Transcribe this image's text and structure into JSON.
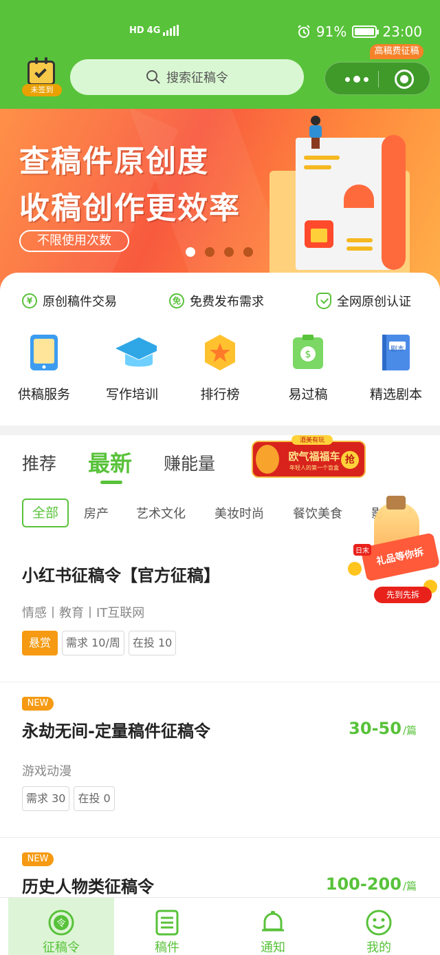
{
  "status_bar": {
    "network": "HD",
    "signal": "4G",
    "battery_pct": "91%",
    "time": "23:00"
  },
  "header": {
    "checkin_label": "未签到",
    "search_placeholder": "搜索征稿令"
  },
  "banner": {
    "line1": "查稿件原创度",
    "line2": "收稿创作更效率",
    "pill": "不限使用次数",
    "slide_count": 4,
    "active_slide": 1
  },
  "features": [
    "原创稿件交易",
    "免费发布需求",
    "全网原创认证"
  ],
  "feature_icons": [
    "yuan-circle-icon",
    "free-circle-icon",
    "shield-check-icon"
  ],
  "services": [
    {
      "label": "供稿服务",
      "icon": "tablet-icon"
    },
    {
      "label": "写作培训",
      "icon": "graduation-cap-icon"
    },
    {
      "label": "排行榜",
      "icon": "star-hexagon-icon"
    },
    {
      "label": "易过稿",
      "icon": "money-board-icon"
    },
    {
      "label": "精选剧本",
      "icon": "script-book-icon",
      "badge": "高稿费征稿",
      "book_text": "剧本"
    }
  ],
  "tabs": [
    {
      "label": "推荐",
      "active": false
    },
    {
      "label": "最新",
      "active": true
    },
    {
      "label": "赚能量",
      "active": false
    }
  ],
  "promo": {
    "top": "酒美有玩",
    "title": "欧气福福车",
    "sub": "年轻人的第一个盲盒",
    "action": "抢"
  },
  "categories": [
    "全部",
    "房产",
    "艺术文化",
    "美妆时尚",
    "餐饮美食",
    "影"
  ],
  "float_gift": {
    "tag": "礼品等你拆",
    "button": "先到先拆",
    "day_tag": "日末"
  },
  "listings": [
    {
      "is_new": false,
      "title": "小红书征稿令【官方征稿】",
      "tags": "情感丨教育丨IT互联网",
      "chips": [
        "悬赏",
        "需求 10/周",
        "在投 10"
      ],
      "price": "",
      "unit": ""
    },
    {
      "is_new": true,
      "new_label": "NEW",
      "title": "永劫无间-定量稿件征稿令",
      "tags": "游戏动漫",
      "chips": [
        "需求 30",
        "在投 0"
      ],
      "price": "30-50",
      "unit": "/篇"
    },
    {
      "is_new": true,
      "new_label": "NEW",
      "title": "历史人物类征稿令",
      "tags": "",
      "chips": [],
      "price": "100-200",
      "unit": "/篇"
    }
  ],
  "bottom_nav": [
    {
      "label": "征稿令",
      "icon": "ling-badge-icon",
      "active": true
    },
    {
      "label": "稿件",
      "icon": "document-list-icon",
      "active": false
    },
    {
      "label": "通知",
      "icon": "bell-icon",
      "active": false
    },
    {
      "label": "我的",
      "icon": "smiley-face-icon",
      "active": false
    }
  ],
  "colors": {
    "brand_green": "#58c23a",
    "accent_orange": "#f59a12",
    "banner_red": "#f85a3e"
  }
}
